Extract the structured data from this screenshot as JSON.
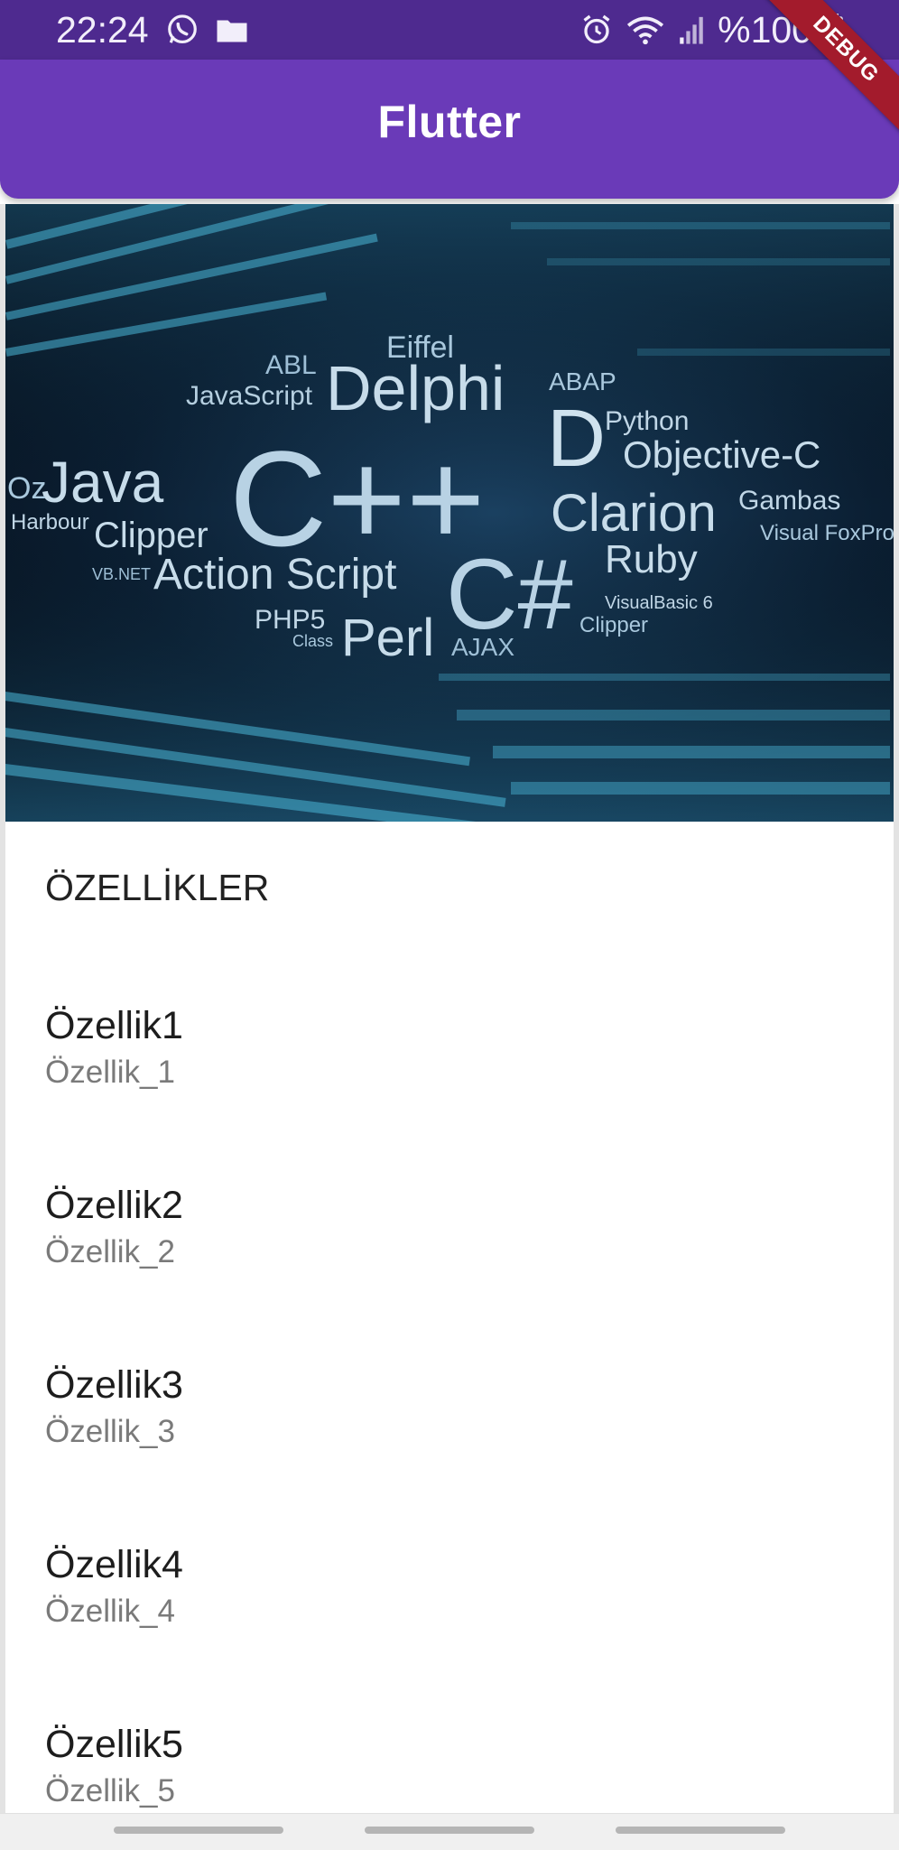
{
  "status_bar": {
    "time": "22:24",
    "battery": "%100",
    "icons": [
      "whatsapp-icon",
      "folder-icon",
      "alarm-icon",
      "wifi-icon",
      "signal-icon",
      "battery-icon"
    ]
  },
  "app_bar": {
    "title": "Flutter"
  },
  "debug_banner": "DEBUG",
  "hero_image": {
    "description": "programming languages banner",
    "words": [
      "Delphi",
      "Eiffel",
      "ABAP",
      "Python",
      "Objective-C",
      "ABL",
      "JavaScript",
      "Java",
      "Oz",
      "Harbour",
      "Clipper",
      "VB.NET",
      "C++",
      "Clarion",
      "Gambas",
      "Visual FoxPro",
      "C#",
      "Ruby",
      "Action Script",
      "PHP5",
      "Class",
      "Perl",
      "AJAX",
      "VisualBasic 6",
      "Clipper"
    ]
  },
  "list": {
    "header": "ÖZELLİKLER",
    "items": [
      {
        "title": "Özellik1",
        "subtitle": "Özellik_1"
      },
      {
        "title": "Özellik2",
        "subtitle": "Özellik_2"
      },
      {
        "title": "Özellik3",
        "subtitle": "Özellik_3"
      },
      {
        "title": "Özellik4",
        "subtitle": "Özellik_4"
      },
      {
        "title": "Özellik5",
        "subtitle": "Özellik_5"
      }
    ]
  },
  "colors": {
    "status_bar": "#4e2a8f",
    "app_bar": "#6a3ab8",
    "debug_ribbon": "#a31b2c"
  }
}
